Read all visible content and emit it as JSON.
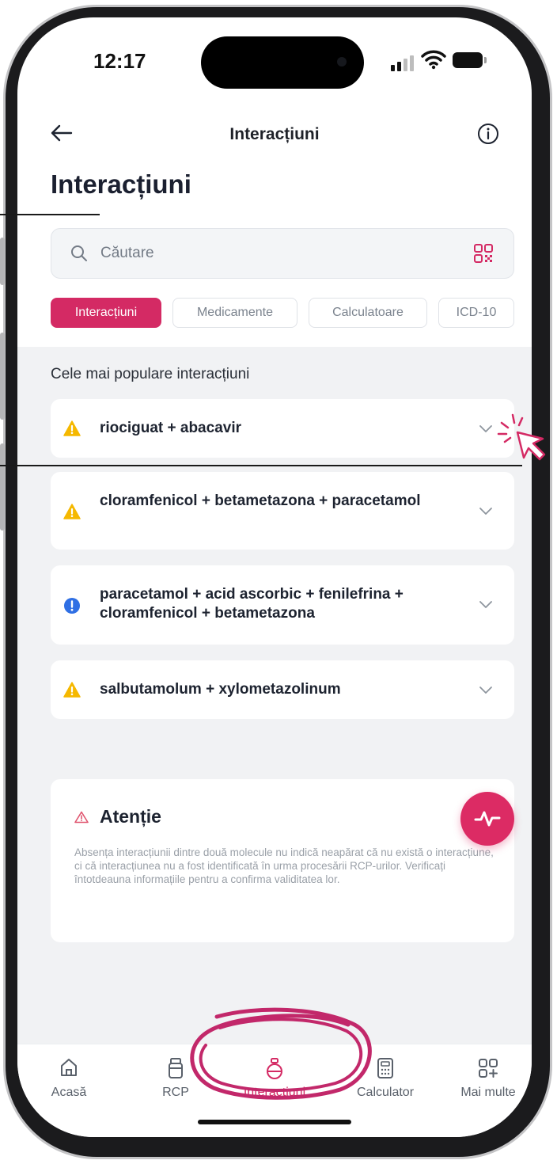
{
  "status_bar": {
    "time": "12:17"
  },
  "nav": {
    "title": "Interacțiuni"
  },
  "page": {
    "title": "Interacțiuni"
  },
  "search": {
    "placeholder": "Căutare"
  },
  "filters": [
    {
      "label": "Interacțiuni",
      "active": true
    },
    {
      "label": "Medicamente",
      "active": false
    },
    {
      "label": "Calculatoare",
      "active": false
    },
    {
      "label": "ICD-10",
      "active": false
    }
  ],
  "section": {
    "label": "Cele mai populare interacțiuni"
  },
  "interactions": [
    {
      "text": "riociguat + abacavir",
      "severity": "warning",
      "icon": "warning-triangle-icon"
    },
    {
      "text": "cloramfenicol + betametazona + paracetamol",
      "severity": "warning",
      "icon": "warning-triangle-icon"
    },
    {
      "text": "paracetamol + acid ascorbic + fenilefrina + cloramfenicol + betametazona",
      "severity": "info",
      "icon": "info-exclamation-icon"
    },
    {
      "text": "salbutamolum + xylometazolinum",
      "severity": "warning",
      "icon": "warning-triangle-icon"
    }
  ],
  "warning": {
    "title": "Atenție",
    "body": "Absența interacțiunii dintre două molecule nu indică neapărat că nu există o interacțiune, ci că interacțiunea nu a fost identificată în urma procesării RCP-urilor. Verificați întotdeauna informațiile pentru a confirma validitatea lor."
  },
  "tabs": [
    {
      "label": "Acasă",
      "icon": "home-icon",
      "active": false
    },
    {
      "label": "RCP",
      "icon": "pill-bottle-icon",
      "active": false
    },
    {
      "label": "Interacțiuni",
      "icon": "flask-icon",
      "active": true
    },
    {
      "label": "Calculator",
      "icon": "calculator-icon",
      "active": false
    },
    {
      "label": "Mai multe",
      "icon": "grid-plus-icon",
      "active": false
    }
  ],
  "colors": {
    "accent": "#d42a64",
    "warning": "#f5b800",
    "info": "#2f6fe4",
    "background": "#f1f2f4"
  }
}
